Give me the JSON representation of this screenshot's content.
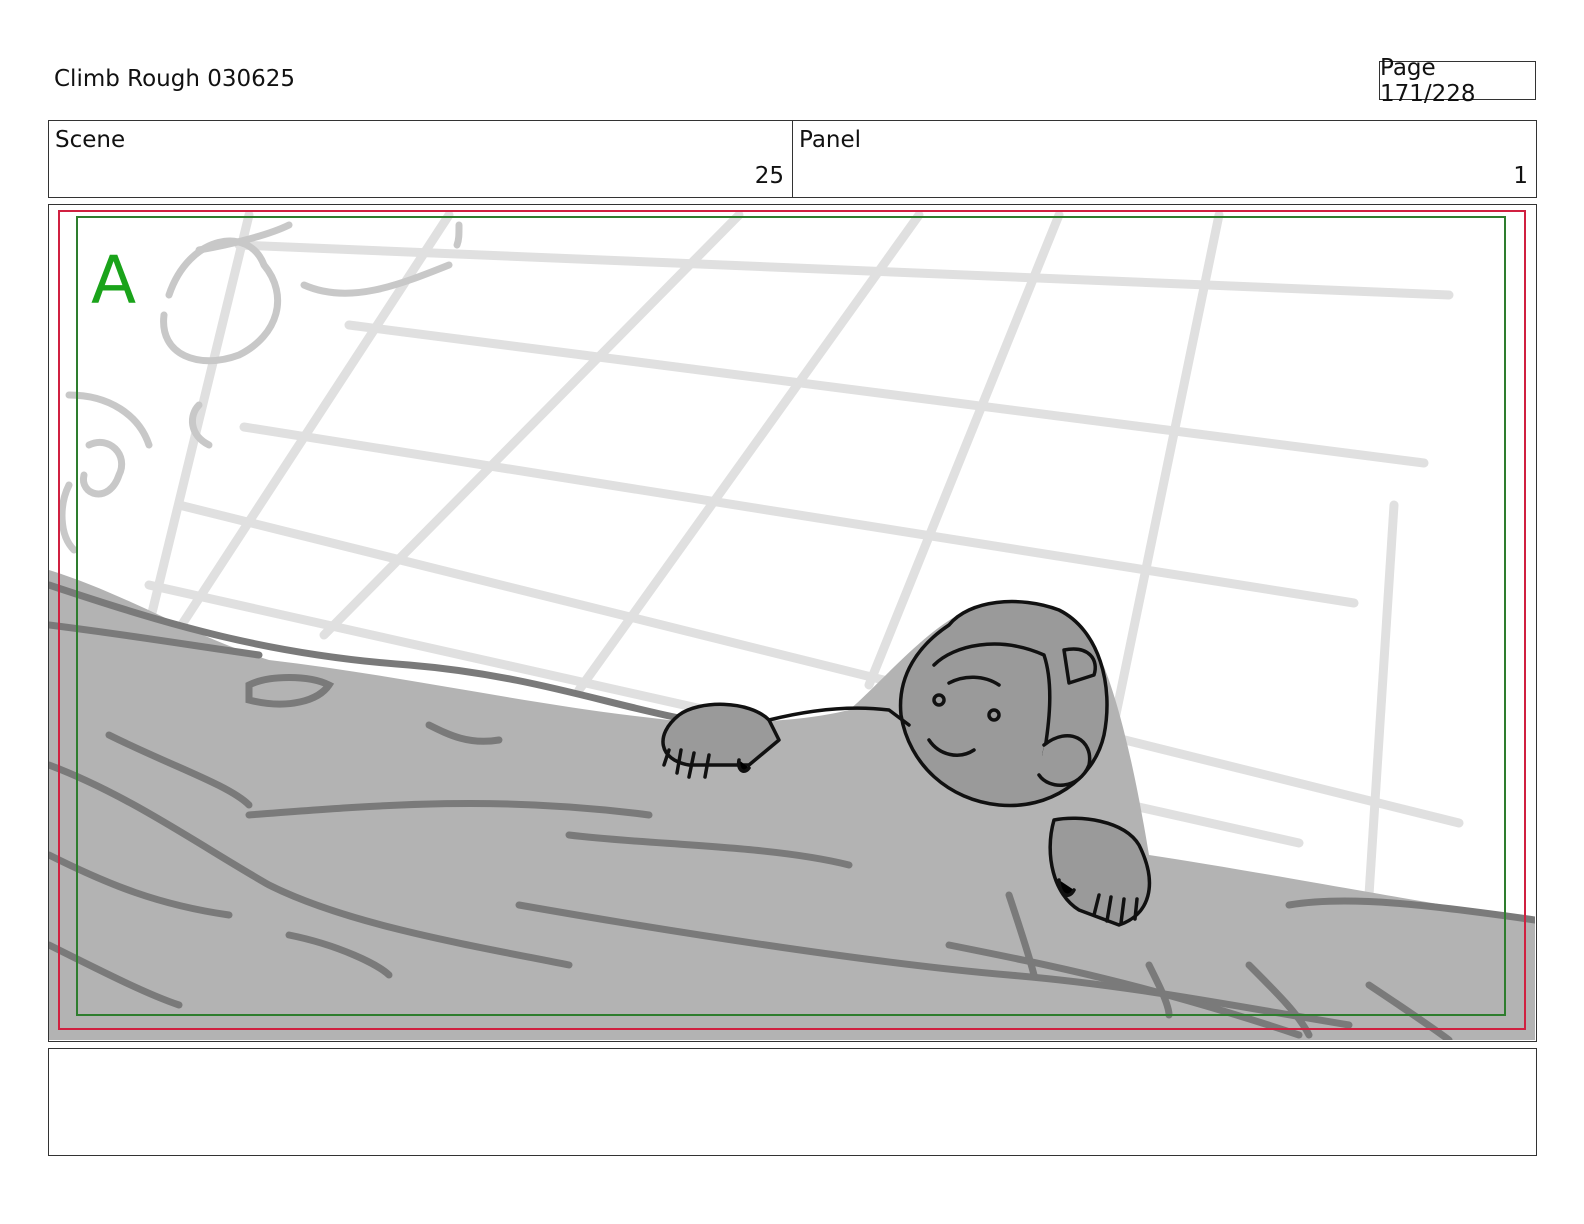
{
  "header": {
    "title": "Climb Rough 030625",
    "page_label": "Page 171/228"
  },
  "info": {
    "scene_label": "Scene",
    "scene_value": "25",
    "panel_label": "Panel",
    "panel_value": "1"
  },
  "panel": {
    "camera_letter": "A",
    "camera_color": "#1aa31a",
    "safe_frame_color": "#2e7d2e",
    "outer_frame_color": "#d02040",
    "drawing": "storyboard-sketch"
  },
  "notes": {
    "text": ""
  }
}
